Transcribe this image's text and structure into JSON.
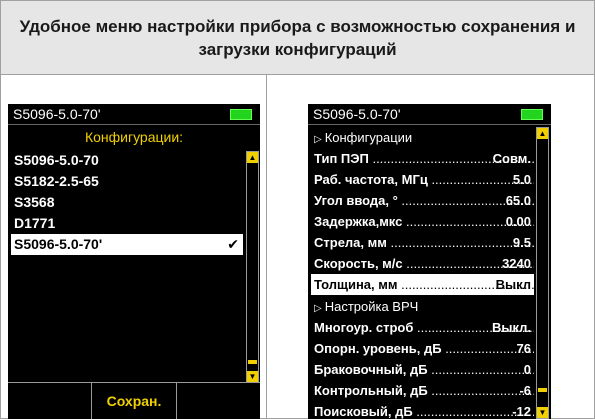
{
  "header": {
    "title": "Удобное меню настройки прибора с возможностью сохранения и загрузки конфигураций"
  },
  "left_screen": {
    "device_name": "S5096-5.0-70'",
    "battery_icon": "battery-full-icon",
    "title": "Конфигурации:",
    "items": [
      "S5096-5.0-70",
      "S5182-2.5-65",
      "S3568",
      "D1771",
      "S5096-5.0-70'"
    ],
    "selected_index": 4,
    "check_mark": "✔",
    "softkeys": [
      "",
      "Сохран.",
      ""
    ],
    "scroll_position": 0.9
  },
  "right_screen": {
    "device_name": "S5096-5.0-70'",
    "battery_icon": "battery-full-icon",
    "rows": [
      {
        "label": "Конфигурации",
        "value": "",
        "type": "section"
      },
      {
        "label": "Тип ПЭП",
        "value": "Совм.",
        "type": "param"
      },
      {
        "label": "Раб. частота, МГц",
        "value": "5.0",
        "type": "param"
      },
      {
        "label": "Угол ввода, °",
        "value": "65.0",
        "type": "param"
      },
      {
        "label": "Задержка,мкс",
        "value": "0.00",
        "type": "param"
      },
      {
        "label": "Стрела, мм",
        "value": "9.5",
        "type": "param"
      },
      {
        "label": "Скорость, м/с",
        "value": "3240",
        "type": "param"
      },
      {
        "label": "Толщина, мм",
        "value": "Выкл",
        "type": "param",
        "selected": true
      },
      {
        "label": "Настройка ВРЧ",
        "value": "",
        "type": "section"
      },
      {
        "label": "Многоур. строб",
        "value": "Выкл.",
        "type": "param"
      },
      {
        "label": "Опорн. уровень, дБ",
        "value": "76",
        "type": "param"
      },
      {
        "label": "Браковочный, дБ",
        "value": "0",
        "type": "param"
      },
      {
        "label": "Контрольный, дБ",
        "value": "-6",
        "type": "param"
      },
      {
        "label": "Поисковый, дБ",
        "value": "-12",
        "type": "param"
      }
    ],
    "scroll_position": 0.9
  },
  "colors": {
    "screen_bg": "#000000",
    "accent_yellow": "#f0d000",
    "battery_green": "#22d41e",
    "header_bg": "#e6e6e6"
  }
}
